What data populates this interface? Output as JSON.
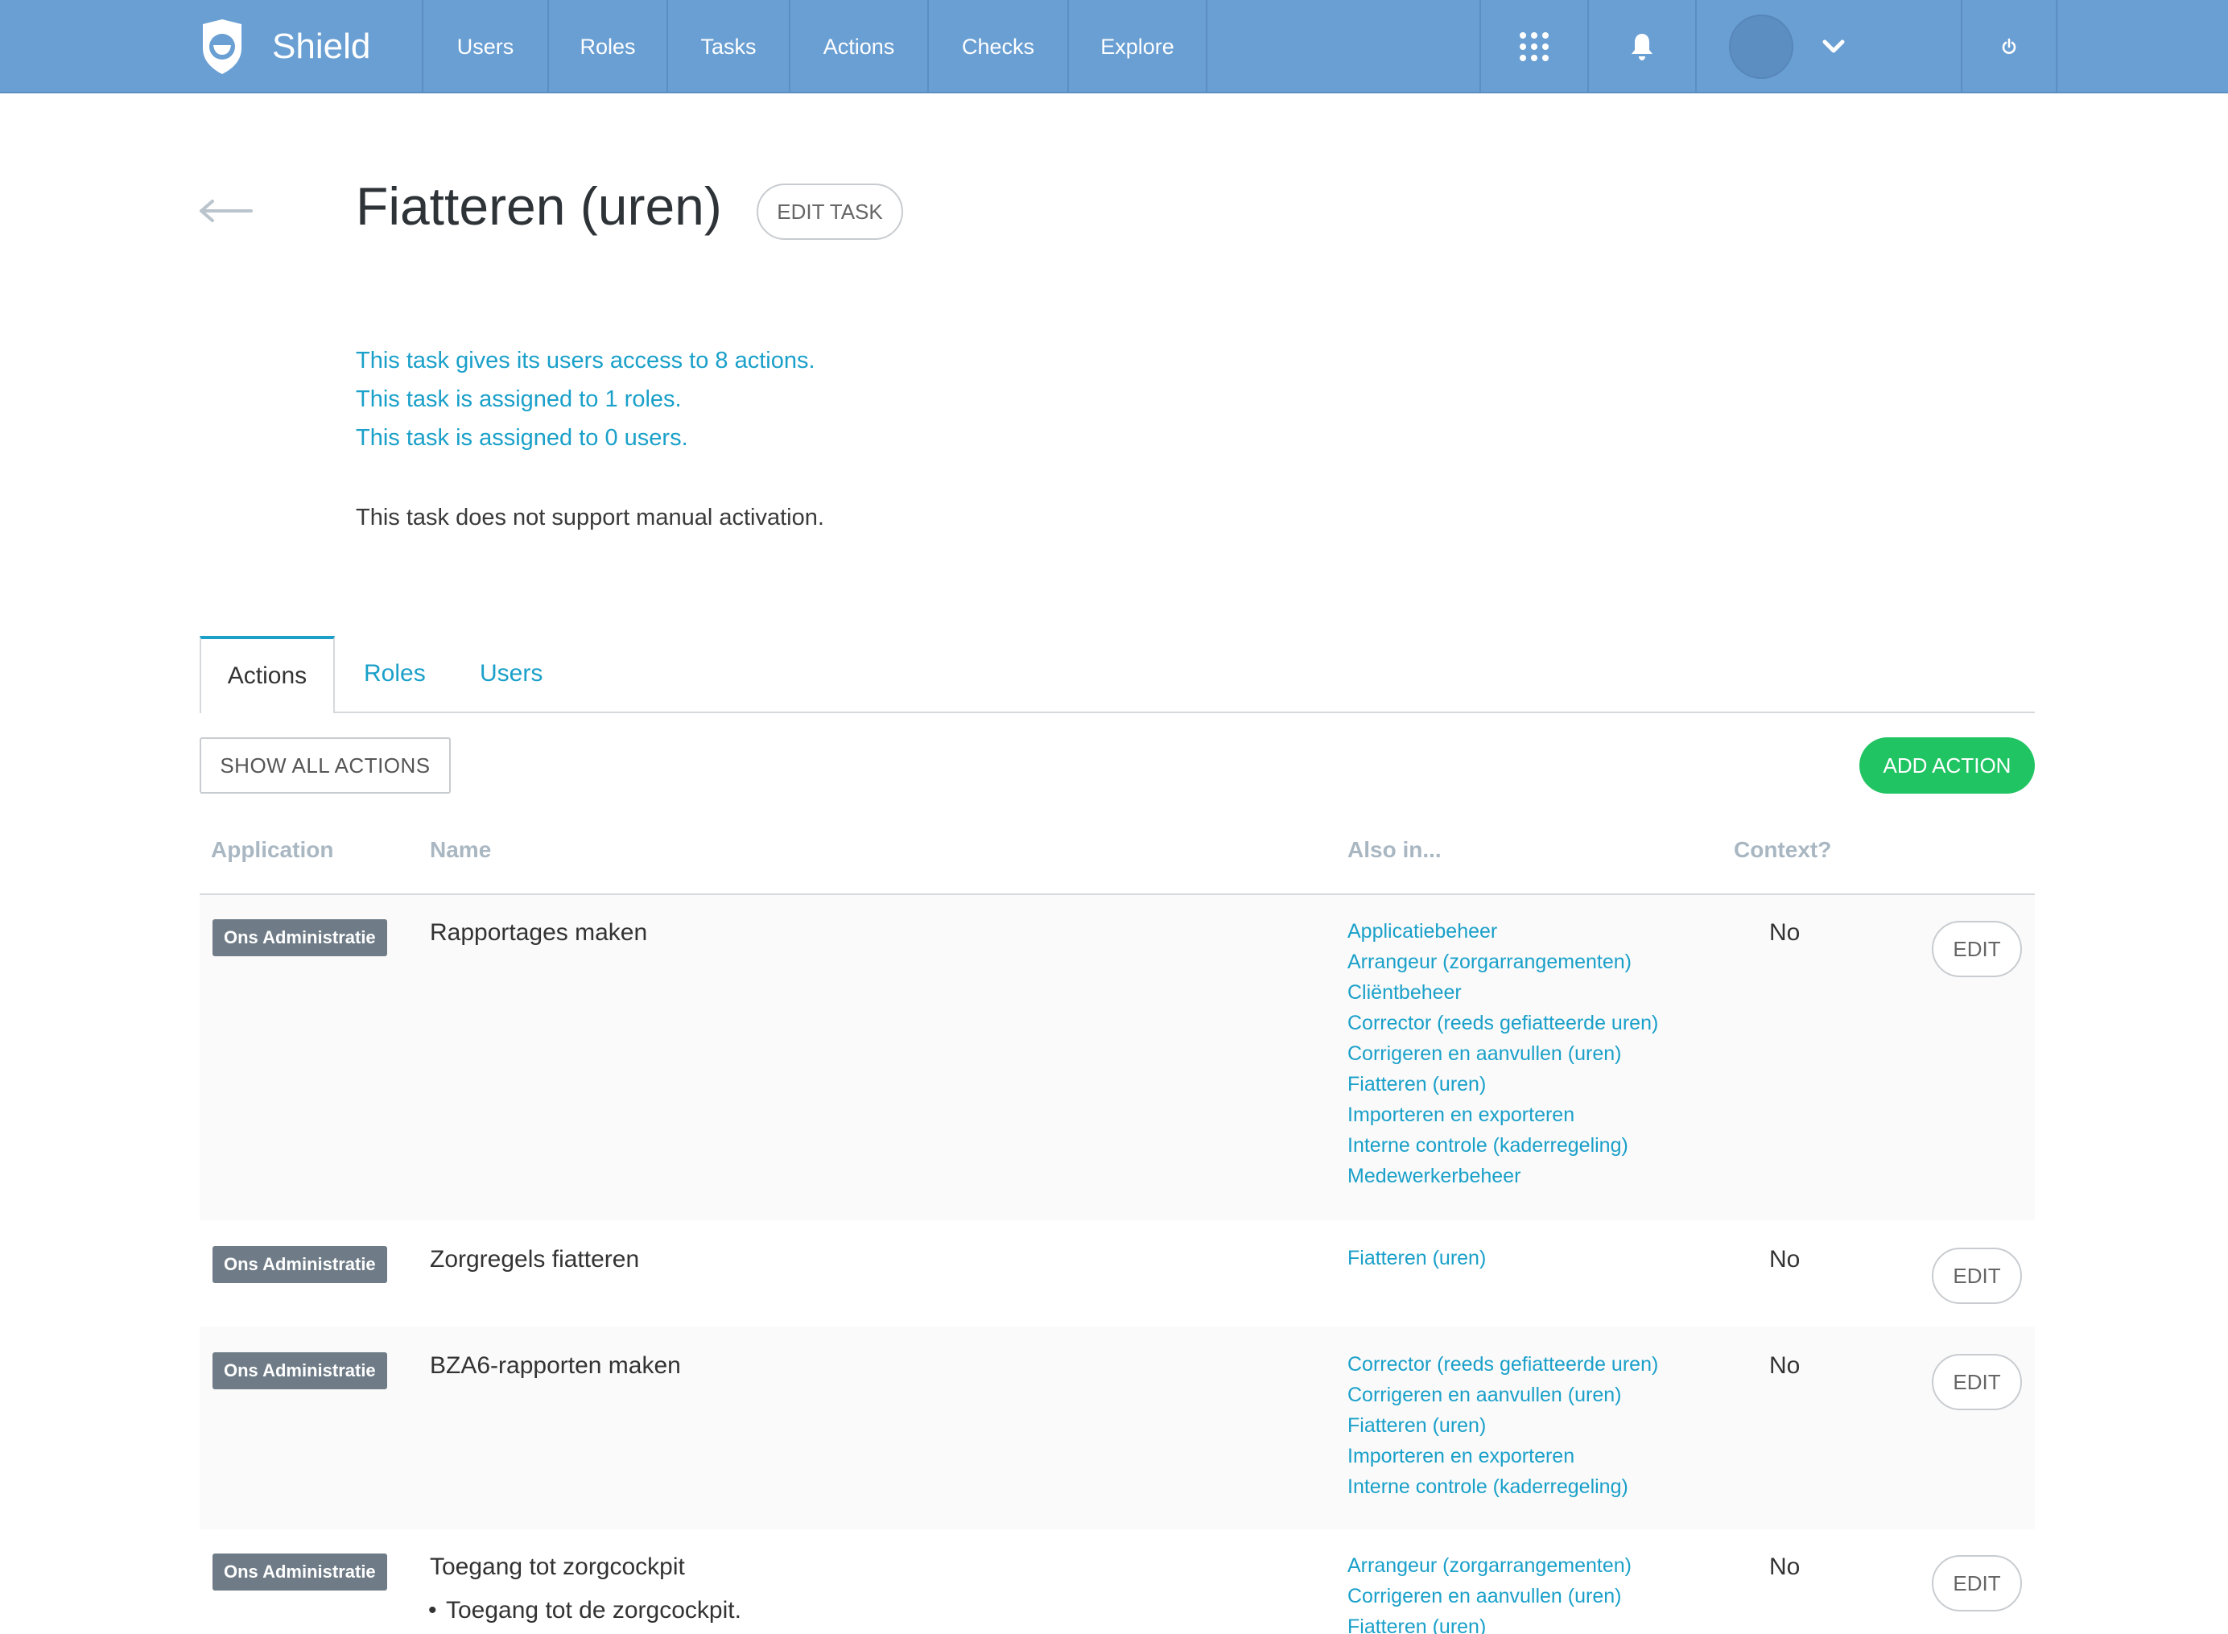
{
  "navbar": {
    "brand": "Shield",
    "links": [
      "Users",
      "Roles",
      "Tasks",
      "Actions",
      "Checks",
      "Explore"
    ],
    "icons": [
      "apps-grid-icon",
      "bell-icon",
      "avatar",
      "chevron-down-icon",
      "power-icon"
    ]
  },
  "header": {
    "title": "Fiatteren (uren)",
    "edit_label": "EDIT TASK"
  },
  "summary": {
    "line1": "This task gives its users access to 8 actions.",
    "line2": "This task is assigned to 1 roles.",
    "line3": "This task is assigned to 0 users.",
    "activation": "This task does not support manual activation."
  },
  "tabs": [
    "Actions",
    "Roles",
    "Users"
  ],
  "toolbar": {
    "show_all": "SHOW ALL ACTIONS",
    "add_action": "ADD ACTION"
  },
  "table": {
    "headers": [
      "Application",
      "Name",
      "Also in...",
      "Context?"
    ],
    "edit_label": "EDIT",
    "rows": [
      {
        "app": "Ons Administratie",
        "name": "Rapportages maken",
        "also": [
          "Applicatiebeheer",
          "Arrangeur (zorgarrangementen)",
          "Cliëntbeheer",
          "Corrector (reeds gefiatteerde uren)",
          "Corrigeren en aanvullen (uren)",
          "Fiatteren (uren)",
          "Importeren en exporteren",
          "Interne controle (kaderregeling)",
          "Medewerkerbeheer"
        ],
        "context": "No"
      },
      {
        "app": "Ons Administratie",
        "name": "Zorgregels fiatteren",
        "also": [
          "Fiatteren (uren)"
        ],
        "context": "No"
      },
      {
        "app": "Ons Administratie",
        "name": "BZA6-rapporten maken",
        "also": [
          "Corrector (reeds gefiatteerde uren)",
          "Corrigeren en aanvullen (uren)",
          "Fiatteren (uren)",
          "Importeren en exporteren",
          "Interne controle (kaderregeling)"
        ],
        "context": "No"
      },
      {
        "app": "Ons Administratie",
        "name": "Toegang tot zorgcockpit",
        "sub": "Toegang tot de zorgcockpit.",
        "also": [
          "Arrangeur (zorgarrangementen)",
          "Corrigeren en aanvullen (uren)",
          "Fiatteren (uren)"
        ],
        "context": "No"
      }
    ]
  }
}
